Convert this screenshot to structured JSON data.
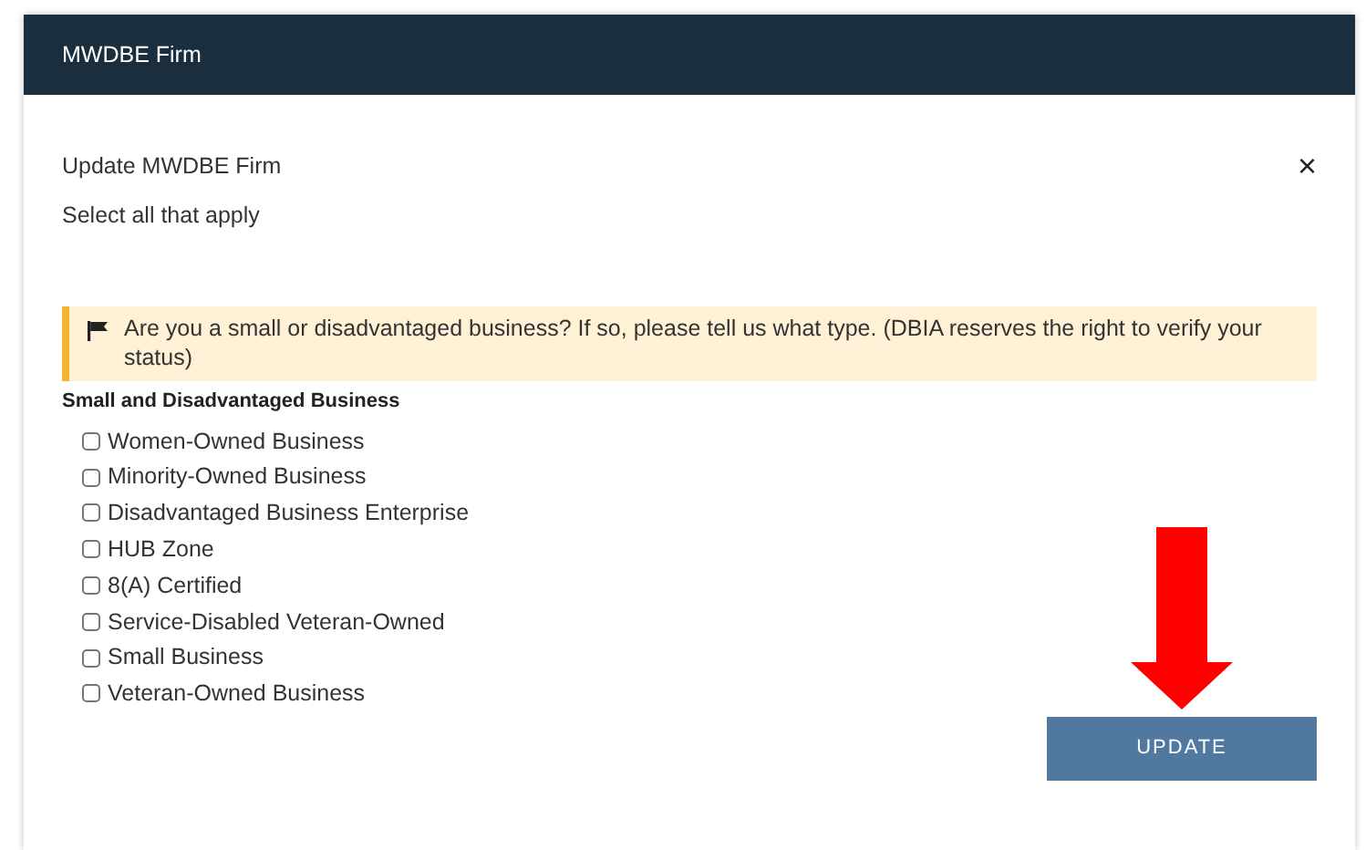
{
  "window": {
    "title": "MWDBE Firm"
  },
  "dialog": {
    "title": "Update MWDBE Firm",
    "subtitle": "Select all that apply",
    "close": "×"
  },
  "notice": {
    "text": "Are you a small or disadvantaged business? If so, please tell us what type. (DBIA reserves the right to verify your status)"
  },
  "group": {
    "label": "Small and Disadvantaged Business",
    "options": [
      {
        "label": "Women-Owned Business",
        "checked": false
      },
      {
        "label": "Minority-Owned Business",
        "checked": false
      },
      {
        "label": "Disadvantaged Business Enterprise",
        "checked": false
      },
      {
        "label": "HUB Zone",
        "checked": false
      },
      {
        "label": "8(A) Certified",
        "checked": false
      },
      {
        "label": "Service-Disabled Veteran-Owned",
        "checked": false
      },
      {
        "label": "Small Business",
        "checked": false
      },
      {
        "label": "Veteran-Owned Business",
        "checked": false
      }
    ]
  },
  "buttons": [
    {
      "label": "UPDATE"
    }
  ]
}
